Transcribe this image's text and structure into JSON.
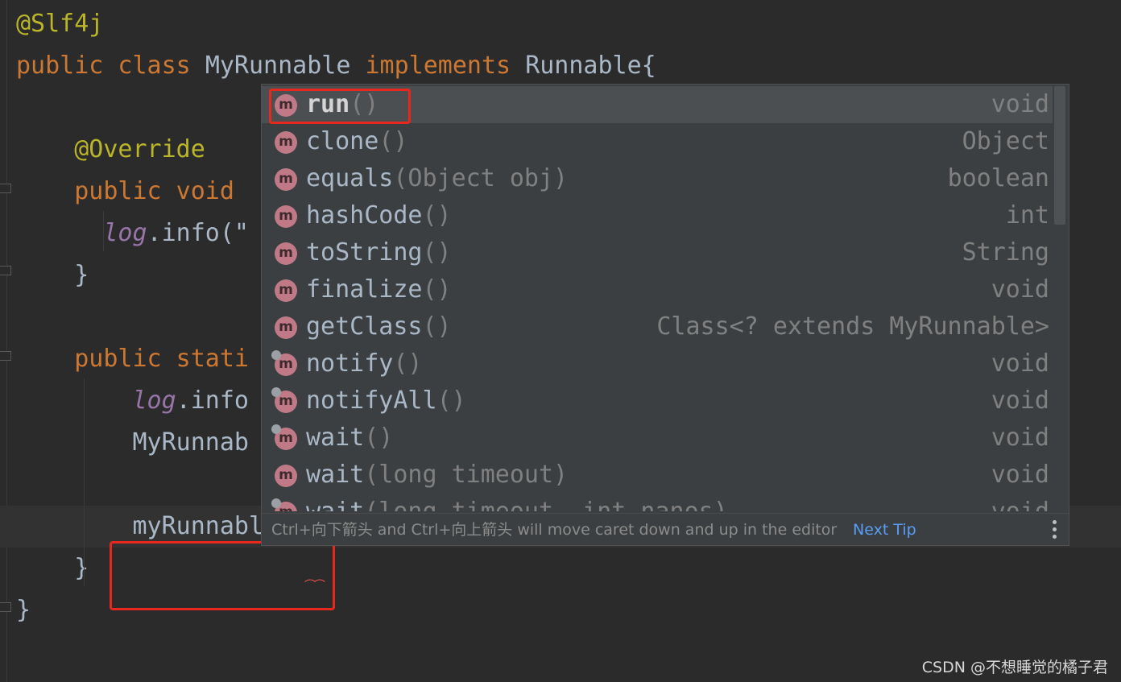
{
  "editor": {
    "lines": [
      {
        "id": "l1",
        "parts": [
          {
            "t": "@Slf4j",
            "c": "ann"
          }
        ]
      },
      {
        "id": "l2",
        "parts": [
          {
            "t": "public class ",
            "c": "kw"
          },
          {
            "t": "MyRunnable ",
            "c": "ident"
          },
          {
            "t": "implements ",
            "c": "kw"
          },
          {
            "t": "Runnable{",
            "c": "ident"
          }
        ]
      },
      {
        "id": "l3",
        "parts": []
      },
      {
        "id": "l4",
        "parts": [
          {
            "t": "    @Override",
            "c": "ann"
          }
        ]
      },
      {
        "id": "l5",
        "parts": [
          {
            "t": "    public void ",
            "c": "kw"
          }
        ]
      },
      {
        "id": "l6",
        "parts": [
          {
            "t": "      ",
            "c": "ident"
          },
          {
            "t": "log",
            "c": "ital"
          },
          {
            "t": ".info(\"",
            "c": "ident"
          }
        ]
      },
      {
        "id": "l7",
        "parts": [
          {
            "t": "    }",
            "c": "ident"
          }
        ]
      },
      {
        "id": "l8",
        "parts": []
      },
      {
        "id": "l9",
        "parts": [
          {
            "t": "    public stati",
            "c": "kw"
          }
        ]
      },
      {
        "id": "l10",
        "parts": [
          {
            "t": "        ",
            "c": "ident"
          },
          {
            "t": "log",
            "c": "ital"
          },
          {
            "t": ".info",
            "c": "ident"
          }
        ]
      },
      {
        "id": "l11",
        "parts": [
          {
            "t": "        MyRunnab",
            "c": "ident"
          }
        ]
      },
      {
        "id": "l12",
        "parts": []
      },
      {
        "id": "l13",
        "parts": [
          {
            "t": "        myRunnable.",
            "c": "ident"
          }
        ]
      },
      {
        "id": "l14",
        "parts": [
          {
            "t": "    }",
            "c": "ident"
          }
        ]
      },
      {
        "id": "l15",
        "parts": [
          {
            "t": "}",
            "c": "ident"
          }
        ]
      }
    ]
  },
  "completion": {
    "items": [
      {
        "name": "run",
        "params": "()",
        "type": "void",
        "selected": true,
        "native": false
      },
      {
        "name": "clone",
        "params": "()",
        "type": "Object",
        "selected": false,
        "native": false
      },
      {
        "name": "equals",
        "params": "(Object obj)",
        "type": "boolean",
        "selected": false,
        "native": false
      },
      {
        "name": "hashCode",
        "params": "()",
        "type": "int",
        "selected": false,
        "native": false
      },
      {
        "name": "toString",
        "params": "()",
        "type": "String",
        "selected": false,
        "native": false
      },
      {
        "name": "finalize",
        "params": "()",
        "type": "void",
        "selected": false,
        "native": false
      },
      {
        "name": "getClass",
        "params": "()",
        "type": "Class<? extends MyRunnable>",
        "selected": false,
        "native": false
      },
      {
        "name": "notify",
        "params": "()",
        "type": "void",
        "selected": false,
        "native": true
      },
      {
        "name": "notifyAll",
        "params": "()",
        "type": "void",
        "selected": false,
        "native": true
      },
      {
        "name": "wait",
        "params": "()",
        "type": "void",
        "selected": false,
        "native": true
      },
      {
        "name": "wait",
        "params": "(long timeout)",
        "type": "void",
        "selected": false,
        "native": false
      },
      {
        "name": "wait",
        "params": "(long timeout, int nanos)",
        "type": "void",
        "selected": false,
        "native": true
      }
    ],
    "icon_letter": "m",
    "tip": "Ctrl+向下箭头 and Ctrl+向上箭头 will move caret down and up in the editor",
    "next_tip": "Next Tip"
  },
  "watermark": "CSDN @不想睡觉的橘子君",
  "colors": {
    "keyword": "#cc7832",
    "annotation": "#bbb529",
    "highlight": "#e8281f",
    "link": "#589df6"
  }
}
